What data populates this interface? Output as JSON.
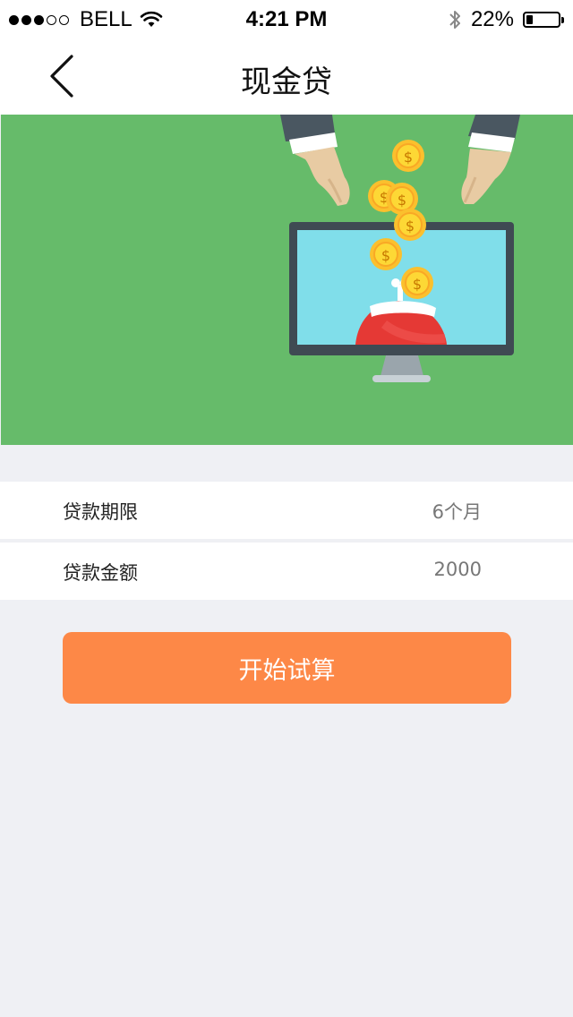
{
  "status_bar": {
    "carrier": "BELL",
    "time": "4:21 PM",
    "battery_text": "22%",
    "battery_level": 0.22,
    "signal_strength": 3,
    "signal_max": 5
  },
  "nav": {
    "title": "现金贷",
    "back_icon": "chevron-left-icon"
  },
  "banner": {
    "background_color": "#66bb6a",
    "illustration": "coins-falling-into-wallet-on-monitor"
  },
  "form": {
    "rows": [
      {
        "label": "贷款期限",
        "value": "6个月"
      },
      {
        "label": "贷款金额",
        "value": "2000"
      }
    ]
  },
  "actions": {
    "calculate_label": "开始试算",
    "calculate_color": "#fd8847"
  }
}
